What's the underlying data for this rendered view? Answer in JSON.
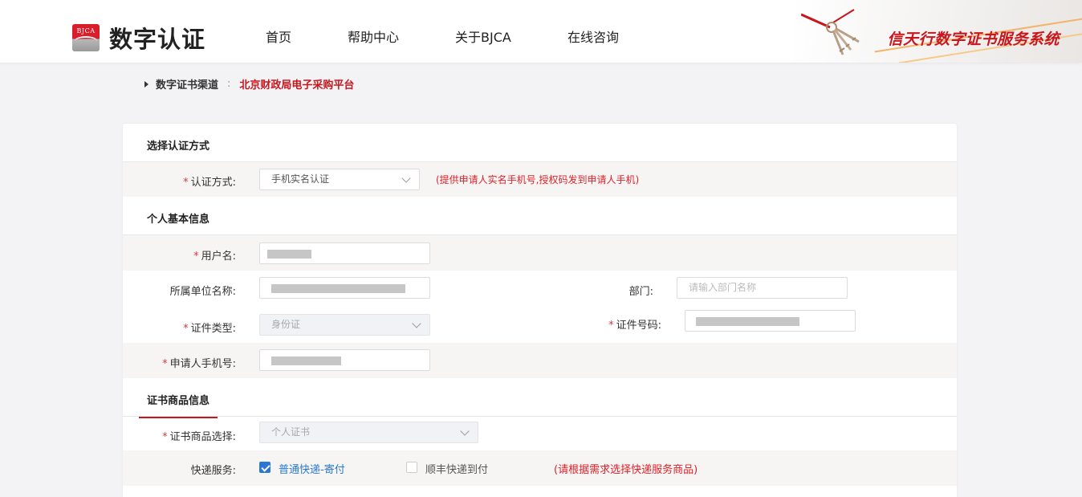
{
  "header": {
    "logo_badge": "BJCA",
    "logo_text": "数字认证",
    "nav": [
      "首页",
      "帮助中心",
      "关于BJCA",
      "在线咨询"
    ],
    "brand_title": "信天行数字证书服务系统"
  },
  "breadcrumb": {
    "label": "数字证书渠道",
    "separator": ":",
    "value": "北京财政局电子采购平台"
  },
  "sections": {
    "auth": {
      "title": "选择认证方式",
      "method_label": "认证方式:",
      "method_value": "手机实名认证",
      "method_note": "(提供申请人实名手机号,授权码发到申请人手机)"
    },
    "personal": {
      "title": "个人基本信息",
      "username_label": "用户名:",
      "org_label": "所属单位名称:",
      "dept_label": "部门:",
      "dept_placeholder": "请输入部门名称",
      "idtype_label": "证件类型:",
      "idtype_value": "身份证",
      "idno_label": "证件号码:",
      "phone_label": "申请人手机号:"
    },
    "product": {
      "title": "证书商品信息",
      "product_label": "证书商品选择:",
      "product_value": "个人证书",
      "express_label": "快递服务:",
      "express_opt1": "普通快递-寄付",
      "express_opt2": "顺丰快递到付",
      "express_note": "(请根据需求选择快递服务商品)"
    }
  },
  "colors": {
    "accent_red": "#c8161d",
    "checkbox_blue": "#2a78d4"
  },
  "icons": [
    "bjca-logo-icon",
    "keys-icon",
    "breadcrumb-triangle-icon",
    "chevron-down-icon",
    "checkbox-icon"
  ]
}
